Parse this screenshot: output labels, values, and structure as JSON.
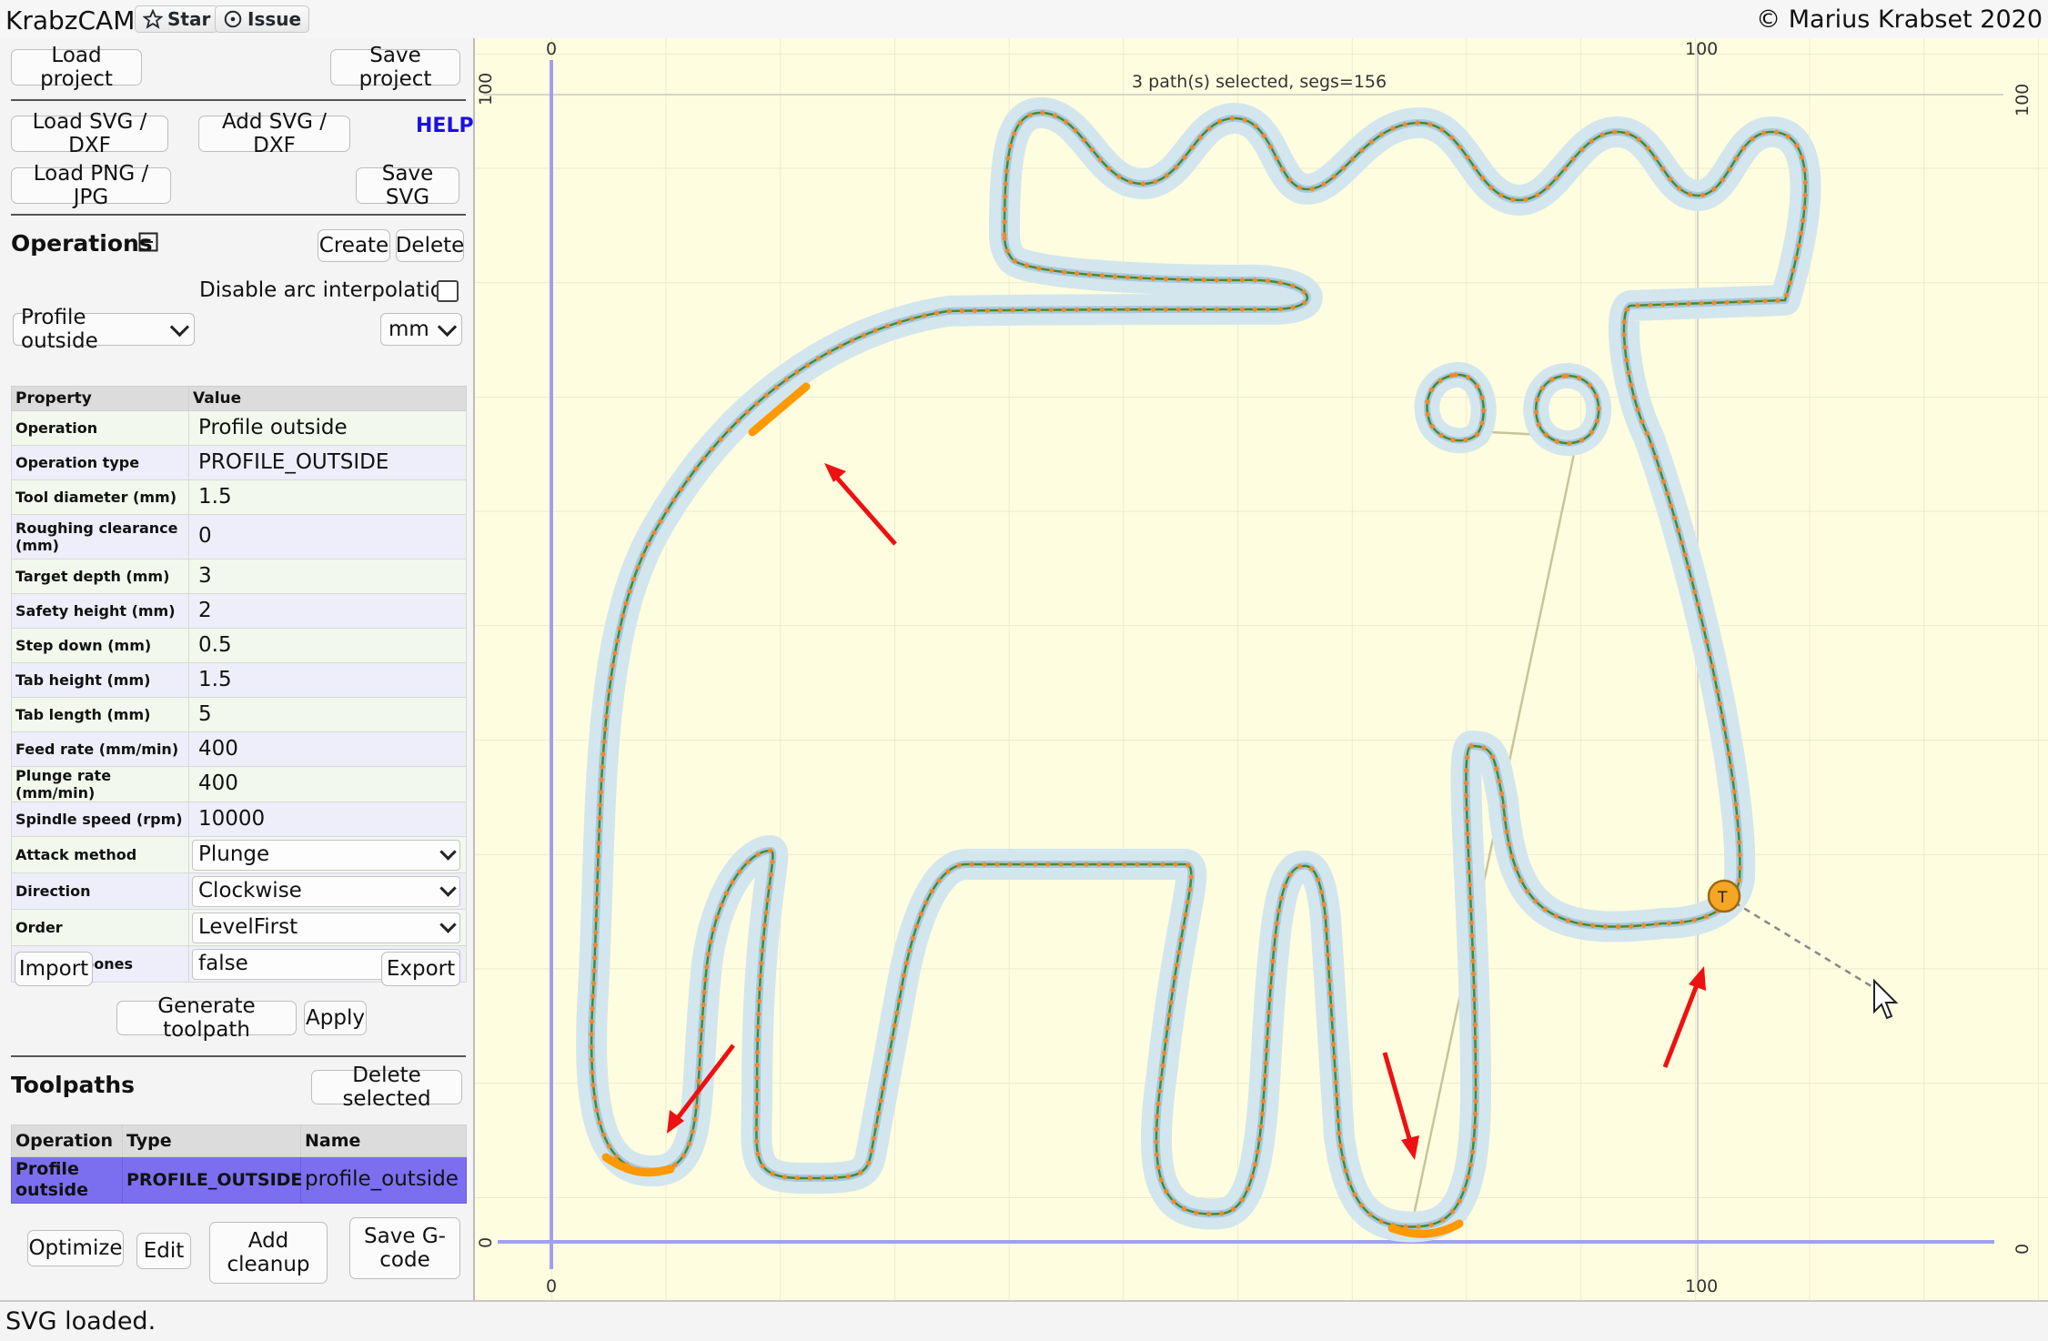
{
  "header": {
    "app_title": "KrabzCAM",
    "star_label": "Star",
    "issue_label": "Issue",
    "copyright": "© Marius Krabset 2020"
  },
  "project": {
    "load_project": "Load project",
    "save_project": "Save project"
  },
  "import": {
    "load_svg": "Load SVG / DXF",
    "add_svg": "Add SVG / DXF",
    "help": "HELP",
    "load_png": "Load PNG / JPG",
    "save_svg": "Save SVG"
  },
  "operations": {
    "title": "Operations",
    "create": "Create",
    "delete": "Delete",
    "disable_arc_label": "Disable arc interpolation",
    "disable_arc_checked": false,
    "operation_select": "Profile outside",
    "unit_select": "mm",
    "table_headers": [
      "Property",
      "Value"
    ],
    "properties": [
      {
        "name": "Operation",
        "value": "Profile outside"
      },
      {
        "name": "Operation type",
        "value": "PROFILE_OUTSIDE"
      },
      {
        "name": "Tool diameter (mm)",
        "value": "1.5"
      },
      {
        "name": "Roughing clearance (mm)",
        "value": "0"
      },
      {
        "name": "Target depth (mm)",
        "value": "3"
      },
      {
        "name": "Safety height (mm)",
        "value": "2"
      },
      {
        "name": "Step down (mm)",
        "value": "0.5"
      },
      {
        "name": "Tab height (mm)",
        "value": "1.5"
      },
      {
        "name": "Tab length (mm)",
        "value": "5"
      },
      {
        "name": "Feed rate (mm/min)",
        "value": "400"
      },
      {
        "name": "Plunge rate (mm/min)",
        "value": "400"
      },
      {
        "name": "Spindle speed (rpm)",
        "value": "10000"
      }
    ],
    "select_properties": [
      {
        "name": "Attack method",
        "value": "Plunge"
      },
      {
        "name": "Direction",
        "value": "Clockwise"
      },
      {
        "name": "Order",
        "value": "LevelFirst"
      },
      {
        "name": "Add dogbones",
        "value": "false"
      }
    ],
    "import_btn": "Import",
    "export_btn": "Export",
    "generate_btn": "Generate toolpath",
    "apply_btn": "Apply"
  },
  "toolpaths": {
    "title": "Toolpaths",
    "delete_selected": "Delete selected",
    "headers": [
      "Operation",
      "Type",
      "Name"
    ],
    "rows": [
      {
        "operation": "Profile outside",
        "type": "PROFILE_OUTSIDE",
        "name": "profile_outside"
      }
    ],
    "optimize": "Optimize",
    "edit": "Edit",
    "add_cleanup": "Add cleanup",
    "save_gcode": "Save G-code"
  },
  "canvas": {
    "selection_info": "3 path(s) selected, segs=156",
    "axis_labels": {
      "x_zero_top": "0",
      "x_hundred_top": "100",
      "x_zero_bottom": "0",
      "x_hundred_bottom": "100",
      "y_hundred_left": "100",
      "y_zero_left": "0",
      "y_hundred_right": "100",
      "y_zero_right": "0"
    },
    "tab_marker": "T",
    "colors": {
      "background": "#fffde0",
      "path": "#4a8a2a",
      "points": "#f08a2a",
      "tab": "#ff9900",
      "arrow": "#ee1111",
      "axis": "#a0a0ee"
    }
  },
  "status": {
    "message": "SVG loaded."
  }
}
